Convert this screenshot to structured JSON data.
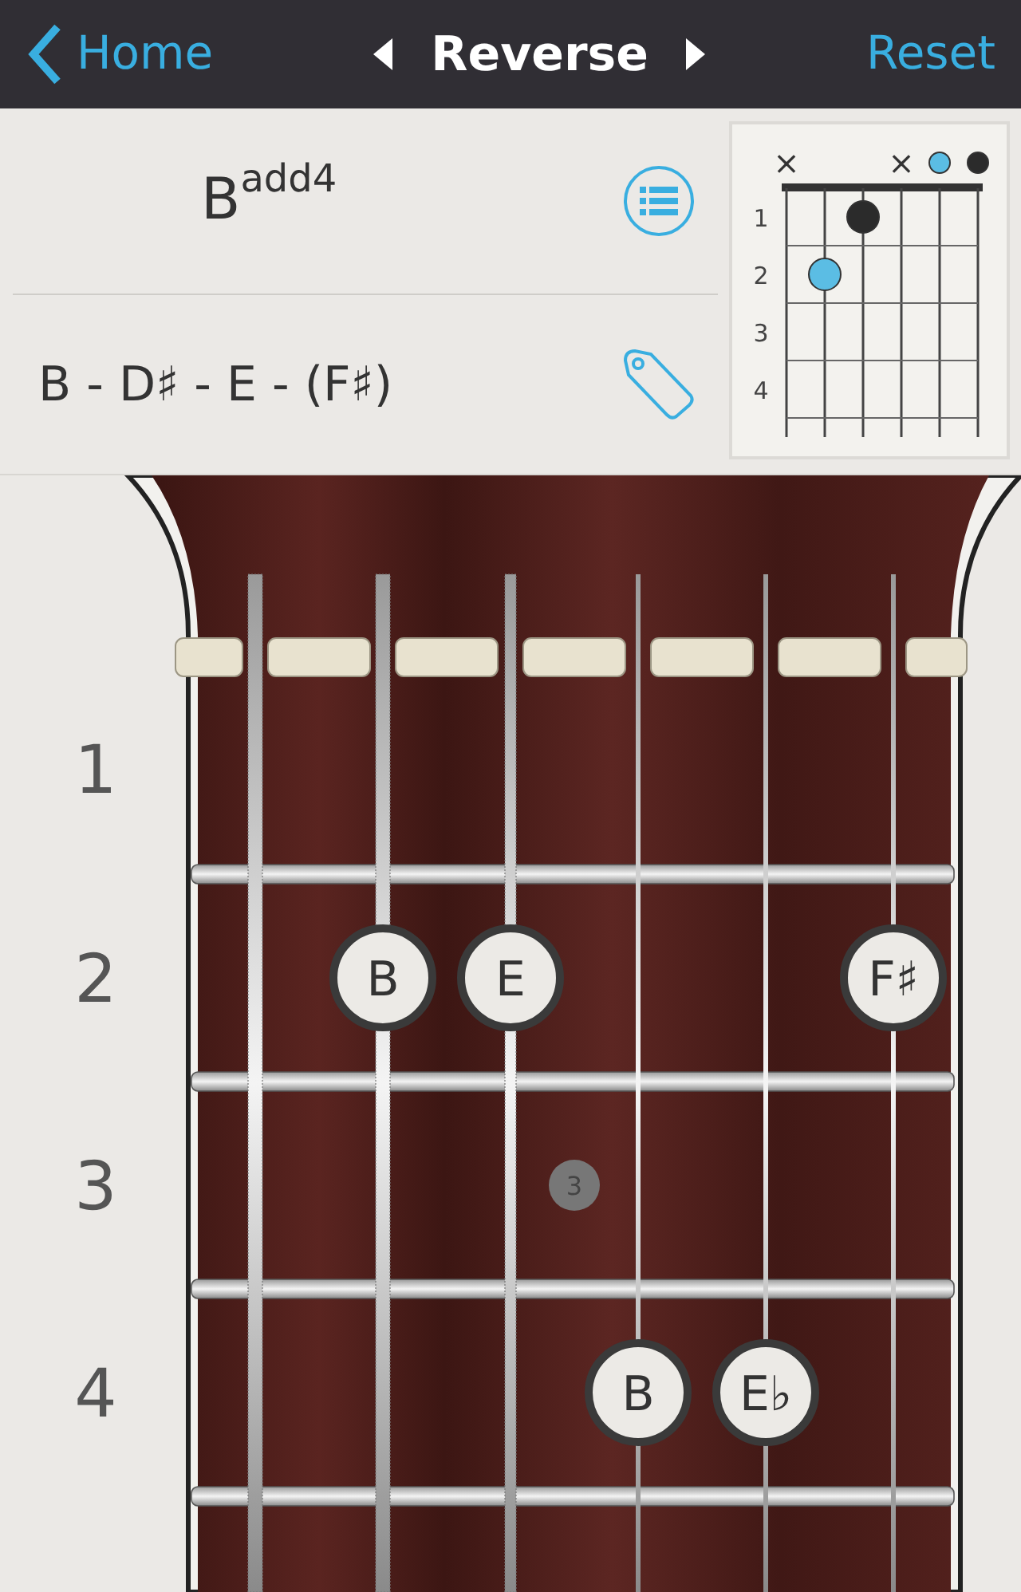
{
  "nav": {
    "back": "Home",
    "title": "Reverse",
    "action": "Reset"
  },
  "chord": {
    "name": "B$^{add4}$",
    "notes": "B - D♯ - E - (F♯)"
  },
  "diagram": {
    "string_marks": [
      {
        "kind": "muted",
        "mark": "×"
      },
      {
        "kind": "none"
      },
      {
        "kind": "none"
      },
      {
        "kind": "muted",
        "mark": "×"
      },
      {
        "kind": "open",
        "color": "#5bbde4"
      },
      {
        "kind": "open",
        "color": "#2b2b2b"
      }
    ],
    "frets": [
      {
        "label": "1",
        "cells": [
          {
            "kind": "empty"
          },
          {
            "kind": "empty"
          },
          {
            "kind": "dot",
            "color": "#2b2b2b"
          },
          {
            "kind": "empty"
          },
          {
            "kind": "empty"
          },
          {
            "kind": "empty"
          }
        ]
      },
      {
        "label": "2",
        "cells": [
          {
            "kind": "empty"
          },
          {
            "kind": "dot",
            "color": "#5bbde4"
          },
          {
            "kind": "empty"
          },
          {
            "kind": "empty"
          },
          {
            "kind": "empty"
          },
          {
            "kind": "empty"
          }
        ]
      },
      {
        "label": "3",
        "cells": [
          {
            "kind": "empty"
          },
          {
            "kind": "empty"
          },
          {
            "kind": "empty"
          },
          {
            "kind": "empty"
          },
          {
            "kind": "empty"
          },
          {
            "kind": "empty"
          }
        ]
      },
      {
        "label": "4",
        "cells": [
          {
            "kind": "empty"
          },
          {
            "kind": "empty"
          },
          {
            "kind": "empty"
          },
          {
            "kind": "empty"
          },
          {
            "kind": "empty"
          },
          {
            "kind": "empty"
          }
        ]
      }
    ]
  },
  "fretboard": {
    "frets": [
      {
        "label": "1",
        "cells": [
          {
            "kind": "empty"
          },
          {
            "kind": "empty"
          },
          {
            "kind": "empty"
          },
          {
            "kind": "empty"
          },
          {
            "kind": "empty"
          },
          {
            "kind": "empty"
          }
        ]
      },
      {
        "label": "2",
        "cells": [
          {
            "kind": "empty"
          },
          {
            "kind": "note",
            "note": "B"
          },
          {
            "kind": "note",
            "note": "E"
          },
          {
            "kind": "empty"
          },
          {
            "kind": "empty"
          },
          {
            "kind": "note",
            "note": "F♯"
          }
        ]
      },
      {
        "label": "3",
        "inlay": "3",
        "cells": [
          {
            "kind": "empty"
          },
          {
            "kind": "empty"
          },
          {
            "kind": "empty"
          },
          {
            "kind": "empty"
          },
          {
            "kind": "empty"
          },
          {
            "kind": "empty"
          }
        ]
      },
      {
        "label": "4",
        "cells": [
          {
            "kind": "empty"
          },
          {
            "kind": "empty"
          },
          {
            "kind": "empty"
          },
          {
            "kind": "note",
            "note": "B"
          },
          {
            "kind": "note",
            "note": "E♭"
          },
          {
            "kind": "empty"
          }
        ]
      }
    ]
  }
}
